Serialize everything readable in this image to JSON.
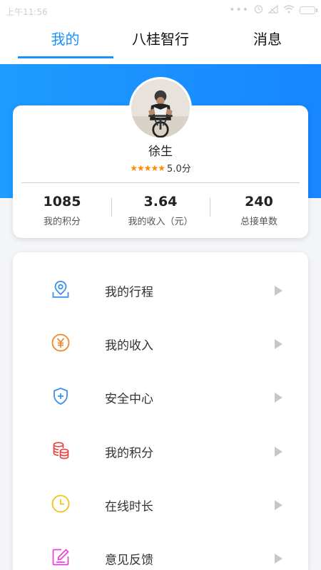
{
  "status_bar": {
    "time": "上午11:56"
  },
  "tabs": [
    {
      "label": "我的",
      "active": true
    },
    {
      "label": "八桂智行",
      "active": false
    },
    {
      "label": "消息",
      "active": false
    }
  ],
  "colors": {
    "accent": "#1890ff",
    "header_gradient_start": "#1e9cff",
    "header_gradient_end": "#1786ff",
    "star": "#ff8a00"
  },
  "profile": {
    "name": "徐生",
    "rating_stars": 5,
    "rating_text": "5.0分",
    "stats": [
      {
        "value": "1085",
        "label": "我的积分"
      },
      {
        "value": "3.64",
        "label": "我的收入（元）"
      },
      {
        "value": "240",
        "label": "总接单数"
      }
    ]
  },
  "menu": [
    {
      "label": "我的行程",
      "icon": "map-pin-icon",
      "color": "#3b8ff0"
    },
    {
      "label": "我的收入",
      "icon": "yuan-coin-icon",
      "color": "#f2852b"
    },
    {
      "label": "安全中心",
      "icon": "shield-plus-icon",
      "color": "#3b8ff0"
    },
    {
      "label": "我的积分",
      "icon": "coin-stack-icon",
      "color": "#e64545"
    },
    {
      "label": "在线时长",
      "icon": "clock-icon",
      "color": "#f3c21a"
    },
    {
      "label": "意见反馈",
      "icon": "edit-icon",
      "color": "#e83fd6"
    }
  ]
}
